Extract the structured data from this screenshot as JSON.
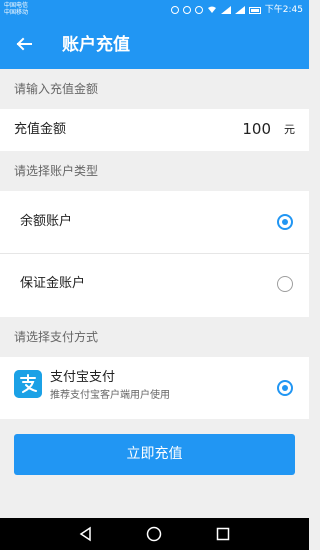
{
  "status_bar": {
    "carrier_1": "中国电信",
    "carrier_2": "中国移动",
    "time": "下午2:45"
  },
  "app_bar": {
    "title": "账户充值"
  },
  "amount_section": {
    "header": "请输入充值金额",
    "label": "充值金额",
    "value": "100",
    "unit": "元"
  },
  "account_section": {
    "header": "请选择账户类型",
    "options": [
      {
        "label": "余额账户",
        "selected": true
      },
      {
        "label": "保证金账户",
        "selected": false
      }
    ]
  },
  "payment_section": {
    "header": "请选择支付方式",
    "method": {
      "title": "支付宝支付",
      "subtitle": "推荐支付宝客户端用户使用",
      "selected": true
    }
  },
  "submit_button": {
    "label": "立即充值"
  },
  "colors": {
    "primary": "#2196f3",
    "alipay": "#1ba1e6",
    "background": "#efefef"
  }
}
